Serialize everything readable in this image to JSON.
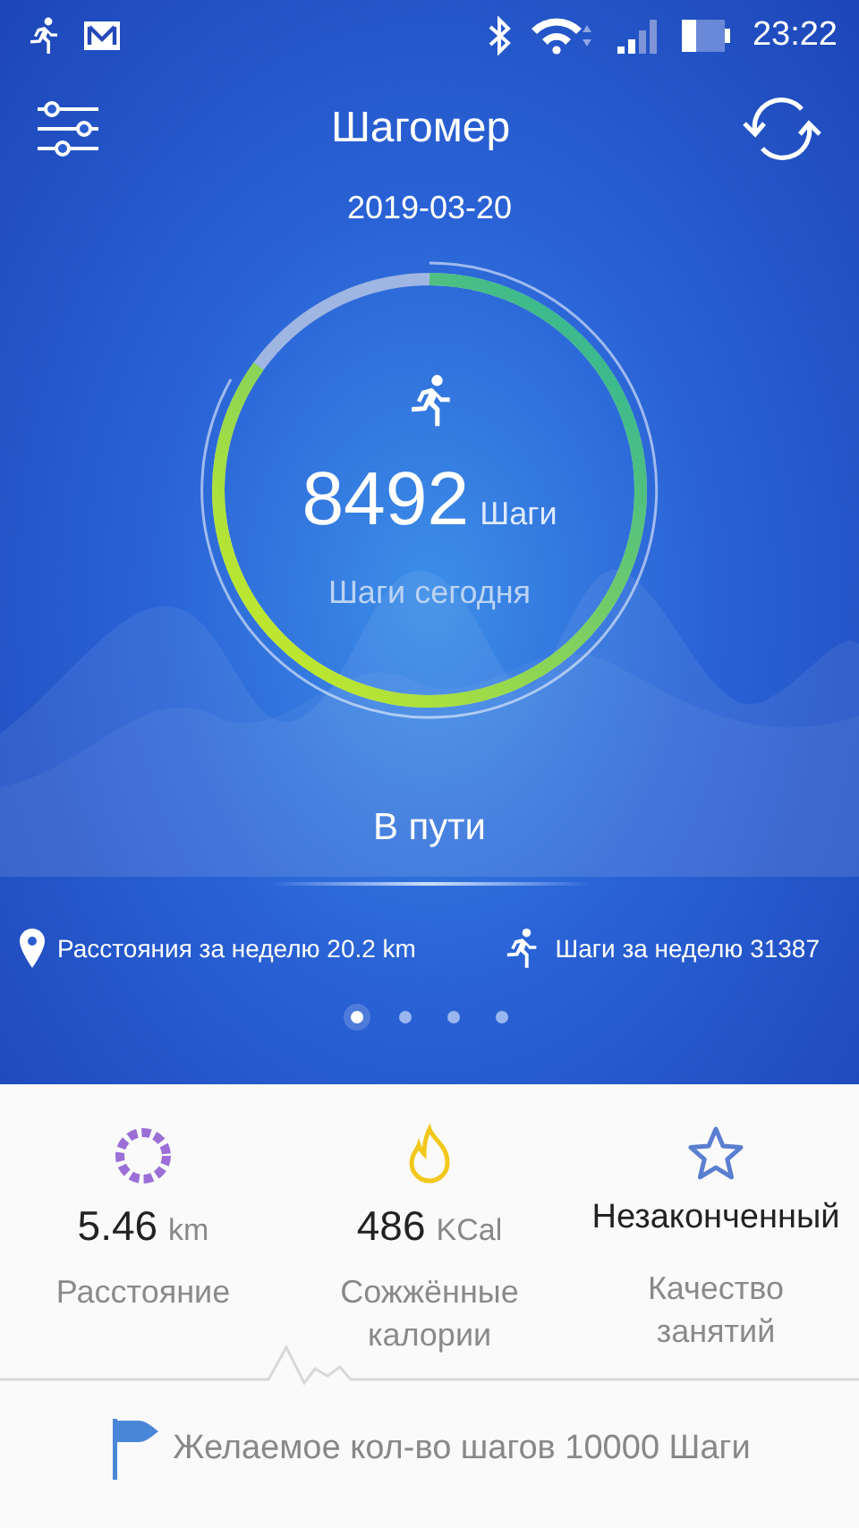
{
  "status_bar": {
    "time": "23:22"
  },
  "header": {
    "title": "Шагомер",
    "date": "2019-03-20"
  },
  "ring": {
    "steps": "8492",
    "unit": "Шаги",
    "caption": "Шаги сегодня"
  },
  "state_label": "В пути",
  "weekly": [
    {
      "kind": "distance",
      "text": "Расстояния за неделю 20.2 km"
    },
    {
      "kind": "steps",
      "text": "Шаги за неделю 31387"
    }
  ],
  "pages": [
    {
      "selected": true
    },
    {
      "selected": false
    },
    {
      "selected": false
    },
    {
      "selected": false
    }
  ],
  "stats": [
    {
      "kind": "distance",
      "value": "5.46",
      "unit": "km",
      "label": "Расстояние"
    },
    {
      "kind": "calories",
      "value": "486",
      "unit": "KCal",
      "label": "Сожжённые калории"
    },
    {
      "kind": "quality",
      "value": "Незаконченный",
      "label": "Качество занятий"
    }
  ],
  "goal": "Желаемое кол-во шагов 10000 Шаги"
}
